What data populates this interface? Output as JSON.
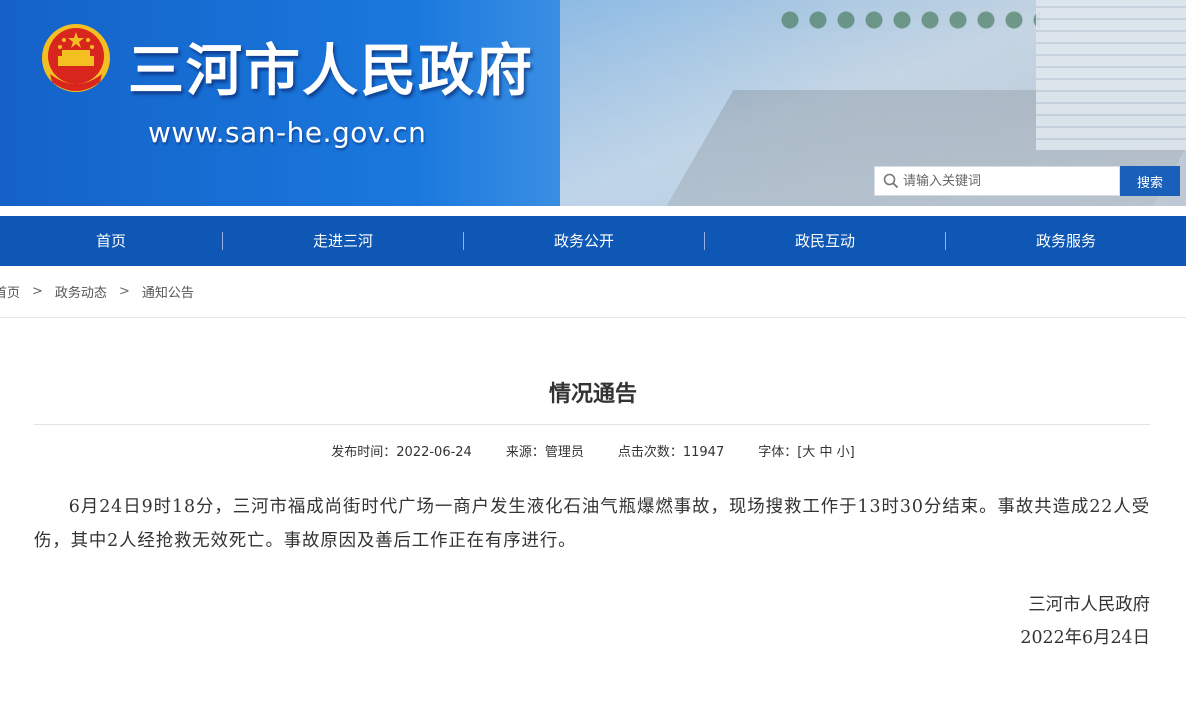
{
  "header": {
    "site_title": "三河市人民政府",
    "site_url": "www.san-he.gov.cn",
    "search": {
      "placeholder": "请输入关键词",
      "button_label": "搜索"
    }
  },
  "nav": {
    "items": [
      {
        "label": "首页"
      },
      {
        "label": "走进三河"
      },
      {
        "label": "政务公开"
      },
      {
        "label": "政民互动"
      },
      {
        "label": "政务服务"
      }
    ]
  },
  "breadcrumb": {
    "items": [
      "首页",
      "政务动态",
      "通知公告"
    ],
    "separator": ">"
  },
  "article": {
    "title": "情况通告",
    "meta": {
      "publish": "发布时间：2022-06-24",
      "source": "来源：管理员",
      "clicks": "点击次数：11947",
      "font_label": "字体：[",
      "size_large": "大",
      "size_medium": "中",
      "size_small": "小",
      "font_close": "]"
    },
    "body": "6月24日9时18分，三河市福成尚街时代广场一商户发生液化石油气瓶爆燃事故，现场搜救工作于13时30分结束。事故共造成22人受伤，其中2人经抢救无效死亡。事故原因及善后工作正在有序进行。",
    "signature": "三河市人民政府",
    "date": "2022年6月24日"
  },
  "colors": {
    "nav_bg": "#0e57b4",
    "search_button": "#1a5fba",
    "emblem_red": "#d8251d",
    "emblem_gold": "#f4c021"
  }
}
